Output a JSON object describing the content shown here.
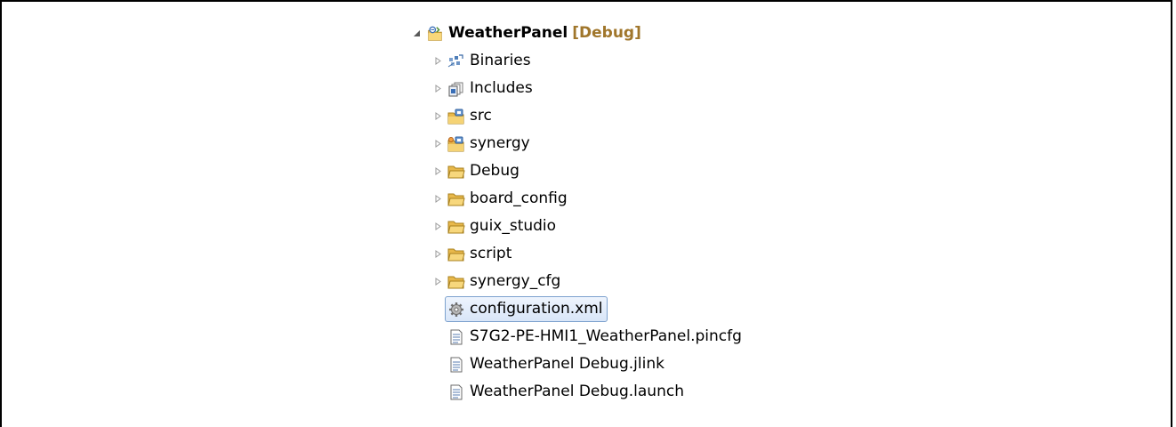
{
  "project": {
    "name": "WeatherPanel",
    "config": "[Debug]",
    "expanded": true
  },
  "children": [
    {
      "label": "Binaries",
      "icon": "binaries-icon",
      "expandable": true
    },
    {
      "label": "Includes",
      "icon": "includes-icon",
      "expandable": true
    },
    {
      "label": "src",
      "icon": "source-folder-icon",
      "expandable": true
    },
    {
      "label": "synergy",
      "icon": "synergy-folder-icon",
      "expandable": true
    },
    {
      "label": "Debug",
      "icon": "folder-icon",
      "expandable": true
    },
    {
      "label": "board_config",
      "icon": "folder-icon",
      "expandable": true
    },
    {
      "label": "guix_studio",
      "icon": "folder-icon",
      "expandable": true
    },
    {
      "label": "script",
      "icon": "folder-icon",
      "expandable": true
    },
    {
      "label": "synergy_cfg",
      "icon": "folder-icon",
      "expandable": true
    },
    {
      "label": "configuration.xml",
      "icon": "gear-icon",
      "expandable": false,
      "selected": true
    },
    {
      "label": "S7G2-PE-HMI1_WeatherPanel.pincfg",
      "icon": "file-icon",
      "expandable": false
    },
    {
      "label": "WeatherPanel Debug.jlink",
      "icon": "file-icon",
      "expandable": false
    },
    {
      "label": "WeatherPanel Debug.launch",
      "icon": "file-icon",
      "expandable": false
    }
  ],
  "colors": {
    "config_label": "#a0762b",
    "folder": "#e8b84a",
    "selection_border": "#7da2ce"
  }
}
